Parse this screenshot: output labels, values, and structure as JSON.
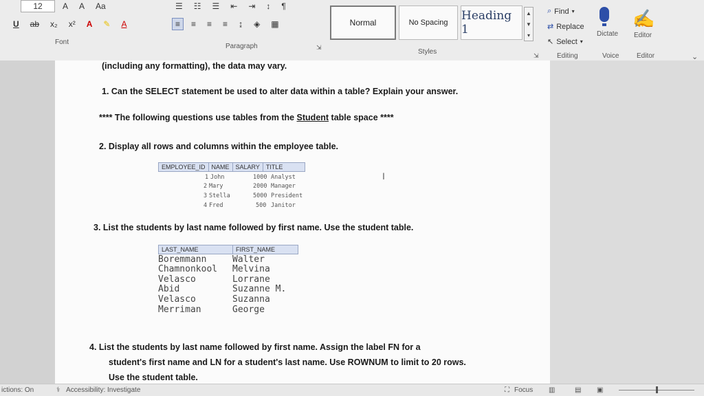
{
  "ribbon": {
    "font_size": "12",
    "font_labels": [
      "A",
      "A",
      "Aa"
    ],
    "format_buttons": [
      "U",
      "ab",
      "x₂",
      "x²",
      "A",
      "A"
    ],
    "groups": {
      "font": "Font",
      "paragraph": "Paragraph",
      "styles": "Styles",
      "editing": "Editing",
      "voice": "Voice",
      "editor": "Editor"
    },
    "styles": {
      "normal": "Normal",
      "no_spacing": "No Spacing",
      "heading1": "Heading 1"
    },
    "editing": {
      "find": "Find",
      "replace": "Replace",
      "select": "Select"
    },
    "dictate": "Dictate",
    "editor_btn": "Editor"
  },
  "document": {
    "intro": "(including any formatting), the data may vary.",
    "q1": "1.  Can the SELECT statement be used to alter data within a table? Explain your answer.",
    "note": "**** The following questions use tables from the ",
    "note_link": "Student",
    "note_end": " table space ****",
    "q2": "2.  Display all rows and columns within the employee table.",
    "q3": "3.  List the students by last name followed by first name. Use the student table.",
    "q4_line1": "4.  List the students by last name followed by first name. Assign the label FN for a",
    "q4_line2": "student's first name and LN for a student's last name. Use ROWNUM to limit to 20 rows.",
    "q4_line3": "Use the student table."
  },
  "employee_table": {
    "headers": [
      "EMPLOYEE_ID",
      "NAME",
      "SALARY",
      "TITLE"
    ],
    "rows": [
      [
        "1",
        "John",
        "1000",
        "Analyst"
      ],
      [
        "2",
        "Mary",
        "2000",
        "Manager"
      ],
      [
        "3",
        "Stella",
        "5000",
        "President"
      ],
      [
        "4",
        "Fred",
        "500",
        "Janitor"
      ]
    ]
  },
  "student_table": {
    "headers": [
      "LAST_NAME",
      "FIRST_NAME"
    ],
    "rows": [
      [
        "Boremmann",
        "Walter"
      ],
      [
        "Chamnonkool",
        "Melvina"
      ],
      [
        "Velasco",
        "Lorrane"
      ],
      [
        "Abid",
        "Suzanne M."
      ],
      [
        "Velasco",
        "Suzanna"
      ],
      [
        "Merriman",
        "George"
      ]
    ]
  },
  "status": {
    "predictions": "ictions: On",
    "accessibility": "Accessibility: Investigate",
    "focus": "Focus"
  },
  "colors": {
    "accent": "#2d4fa8",
    "header_bg": "#d9e1f2"
  }
}
